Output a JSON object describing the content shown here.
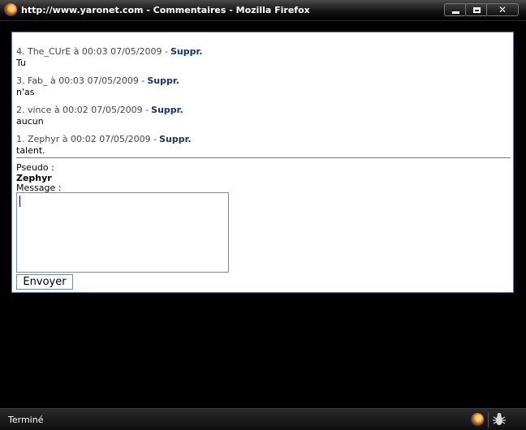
{
  "window": {
    "title": "http://www.yaronet.com - Commentaires - Mozilla Firefox"
  },
  "comments": [
    {
      "meta": "4. The_CUrE à 00:03 07/05/2009 -",
      "action": "Suppr.",
      "text": "Tu"
    },
    {
      "meta": "3. Fab_ à 00:03 07/05/2009 -",
      "action": "Suppr.",
      "text": "n'as"
    },
    {
      "meta": "2. vince à 00:02 07/05/2009 -",
      "action": "Suppr.",
      "text": "aucun"
    },
    {
      "meta": "1. Zephyr à 00:02 07/05/2009 -",
      "action": "Suppr.",
      "text": "talent."
    }
  ],
  "form": {
    "pseudo_label": "Pseudo :",
    "pseudo_value": "Zephyr",
    "message_label": "Message :",
    "message_value": "",
    "send_label": "Envoyer"
  },
  "status": {
    "text": "Terminé"
  },
  "icons": {
    "app": "firefox-icon",
    "status_firefox": "firefox-icon",
    "status_bug": "bug-icon"
  }
}
